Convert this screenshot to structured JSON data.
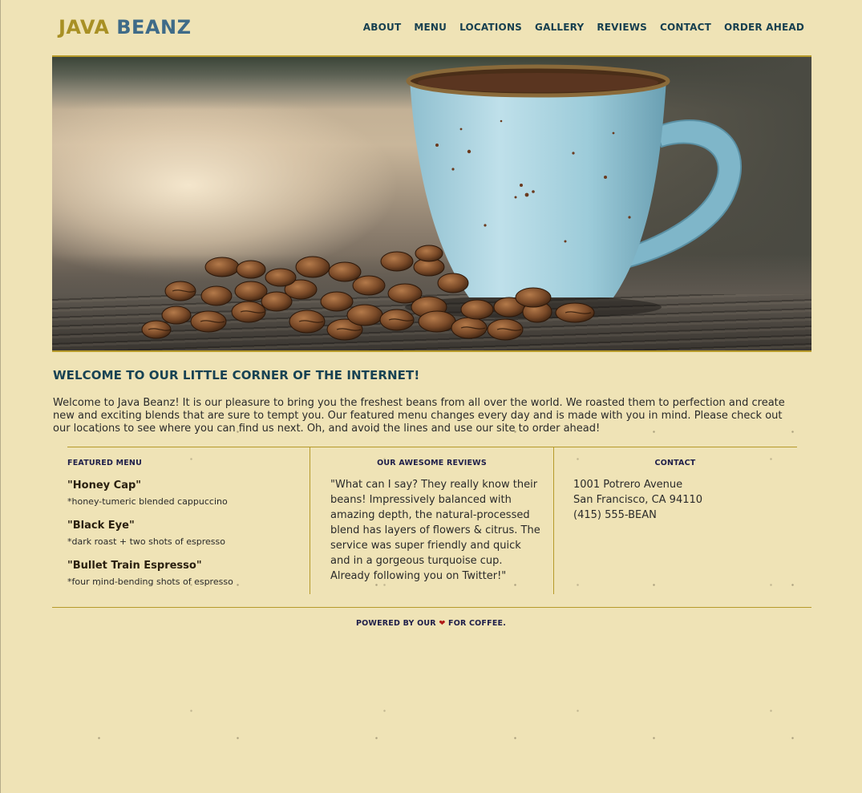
{
  "brand": {
    "word1": "JAVA",
    "word2": "BEANZ"
  },
  "nav": [
    {
      "label": "ABOUT"
    },
    {
      "label": "MENU"
    },
    {
      "label": "LOCATIONS"
    },
    {
      "label": "GALLERY"
    },
    {
      "label": "REVIEWS"
    },
    {
      "label": "CONTACT"
    },
    {
      "label": "ORDER AHEAD"
    }
  ],
  "welcome": {
    "title": "WELCOME TO OUR LITTLE CORNER OF THE INTERNET!",
    "text": "Welcome to Java Beanz! It is our pleasure to bring you the freshest beans from all over the world. We roasted them to perfection and create new and exciting blends that are sure to tempt you. Our featured menu changes every day and is made with you in mind. Please check out our locations to see where you can find us next. Oh, and avoid the lines and use our site to order ahead!"
  },
  "featured_menu": {
    "heading": "FEATURED MENU",
    "items": [
      {
        "name": "\"Honey Cap\"",
        "desc": "*honey-tumeric blended cappuccino"
      },
      {
        "name": "\"Black Eye\"",
        "desc": "*dark roast + two shots of espresso"
      },
      {
        "name": "\"Bullet Train Espresso\"",
        "desc": "*four mind-bending shots of espresso"
      }
    ]
  },
  "reviews": {
    "heading": "OUR AWESOME REVIEWS",
    "text": "\"What can I say? They really know their beans! Impressively balanced with amazing depth, the natural-processed blend has layers of flowers & citrus. The service was super friendly and quick and in a gorgeous turquoise cup. Already following you on Twitter!\""
  },
  "contact": {
    "heading": "CONTACT",
    "address1": "1001 Potrero Avenue",
    "address2": "San Francisco, CA 94110",
    "phone": "(415) 555-BEAN"
  },
  "footer": {
    "before": "POWERED BY OUR",
    "heart": "❤",
    "after": "FOR COFFEE."
  },
  "colors": {
    "background": "#efe3b6",
    "accent_gold": "#b69a2a",
    "brand_gold": "#a89024",
    "brand_blue": "#3f6b88",
    "nav": "#163f4f"
  }
}
